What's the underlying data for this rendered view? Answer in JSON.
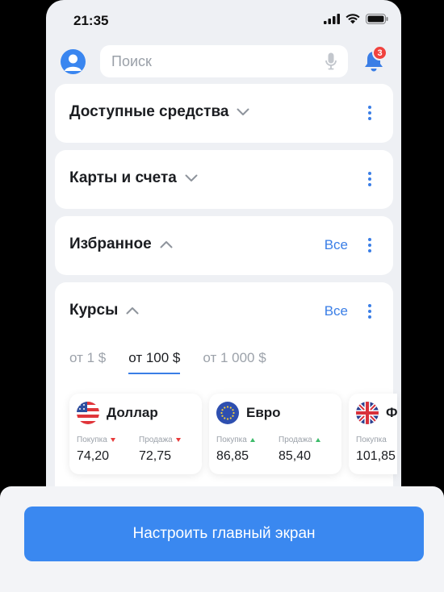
{
  "status_bar": {
    "time": "21:35"
  },
  "search": {
    "placeholder": "Поиск"
  },
  "notifications": {
    "count": "3"
  },
  "sections": {
    "funds": {
      "title": "Доступные средства"
    },
    "cards": {
      "title": "Карты и счета"
    },
    "favorites": {
      "title": "Избранное",
      "all_label": "Все"
    },
    "rates": {
      "title": "Курсы",
      "all_label": "Все"
    }
  },
  "rate_tabs": [
    "от 1 $",
    "от 100 $",
    "от 1 000 $"
  ],
  "currencies": [
    {
      "name": "Доллар",
      "buy_label": "Покупка",
      "sell_label": "Продажа",
      "buy": "74,20",
      "sell": "72,75",
      "trend": "down"
    },
    {
      "name": "Евро",
      "buy_label": "Покупка",
      "sell_label": "Продажа",
      "buy": "86,85",
      "sell": "85,40",
      "trend": "up"
    },
    {
      "name": "Ф",
      "buy_label": "Покупка",
      "buy": "101,85"
    }
  ],
  "bottom": {
    "button_label": "Настроить главный экран"
  },
  "colors": {
    "accent": "#3a7ee6",
    "button": "#3a88f0",
    "badge": "#f0423e",
    "up": "#3dbb6a",
    "down": "#e83b3b"
  }
}
